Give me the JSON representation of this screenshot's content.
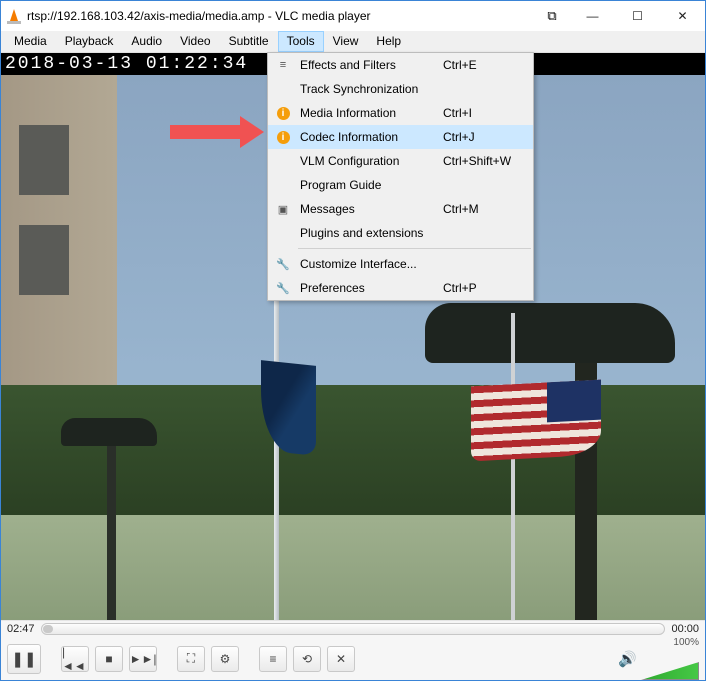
{
  "window": {
    "title": "rtsp://192.168.103.42/axis-media/media.amp - VLC media player"
  },
  "menubar": {
    "items": [
      {
        "label": "Media"
      },
      {
        "label": "Playback"
      },
      {
        "label": "Audio"
      },
      {
        "label": "Video"
      },
      {
        "label": "Subtitle"
      },
      {
        "label": "Tools"
      },
      {
        "label": "View"
      },
      {
        "label": "Help"
      }
    ],
    "open_index": 5
  },
  "tools_menu": {
    "groups": [
      [
        {
          "icon": "sliders",
          "label": "Effects and Filters",
          "shortcut": "Ctrl+E"
        },
        {
          "icon": "",
          "label": "Track Synchronization",
          "shortcut": ""
        },
        {
          "icon": "info",
          "label": "Media Information",
          "shortcut": "Ctrl+I"
        },
        {
          "icon": "info",
          "label": "Codec Information",
          "shortcut": "Ctrl+J",
          "hover": true
        },
        {
          "icon": "",
          "label": "VLM Configuration",
          "shortcut": "Ctrl+Shift+W"
        },
        {
          "icon": "",
          "label": "Program Guide",
          "shortcut": ""
        },
        {
          "icon": "msg",
          "label": "Messages",
          "shortcut": "Ctrl+M"
        },
        {
          "icon": "",
          "label": "Plugins and extensions",
          "shortcut": ""
        }
      ],
      [
        {
          "icon": "wrench",
          "label": "Customize Interface...",
          "shortcut": ""
        },
        {
          "icon": "wrench",
          "label": "Preferences",
          "shortcut": "Ctrl+P"
        }
      ]
    ]
  },
  "video": {
    "timestamp_overlay": "2018-03-13 01:22:34"
  },
  "playback": {
    "elapsed": "02:47",
    "remaining": "00:00",
    "volume_pct": "100%"
  }
}
